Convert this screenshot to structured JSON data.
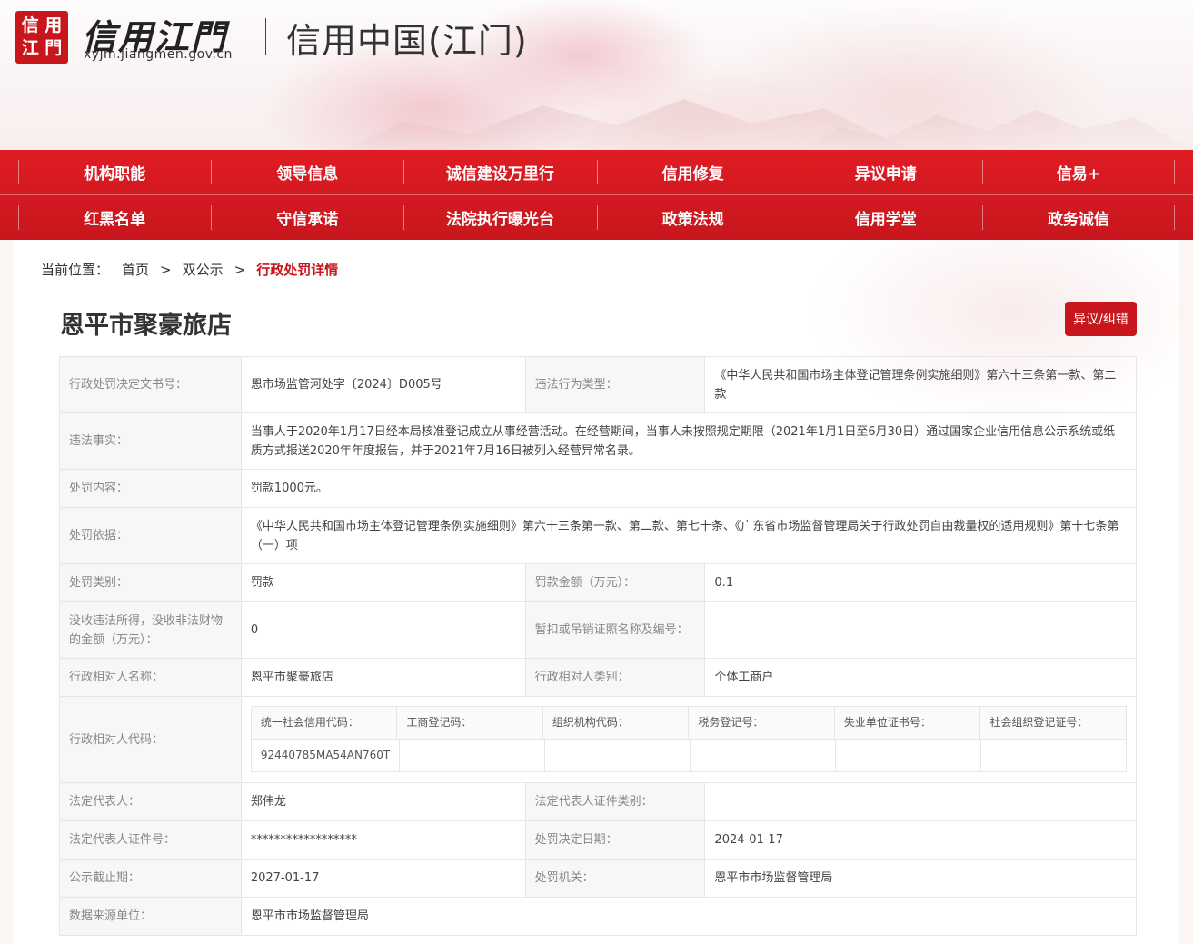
{
  "header": {
    "seal_chars": [
      "信",
      "用",
      "江",
      "門"
    ],
    "brand": "信用江門",
    "url": "xyjm.jiangmen.gov.cn",
    "subtitle": "信用中国(江门)"
  },
  "nav": {
    "row1": [
      "机构职能",
      "领导信息",
      "诚信建设万里行",
      "信用修复",
      "异议申请",
      "信易+"
    ],
    "row2": [
      "红黑名单",
      "守信承诺",
      "法院执行曝光台",
      "政策法规",
      "信用学堂",
      "政务诚信"
    ]
  },
  "breadcrumb": {
    "label": "当前位置：",
    "home": "首页",
    "sep": ">",
    "mid": "双公示",
    "current": "行政处罚详情"
  },
  "page": {
    "title": "恩平市聚豪旅店",
    "objection_button": "异议/纠错"
  },
  "details": {
    "doc_no_label": "行政处罚决定文书号：",
    "doc_no": "恩市场监管河处字〔2024〕D005号",
    "violation_type_label": "违法行为类型：",
    "violation_type": "《中华人民共和国市场主体登记管理条例实施细则》第六十三条第一款、第二款",
    "facts_label": "违法事实：",
    "facts": "当事人于2020年1月17日经本局核准登记成立从事经营活动。在经营期间，当事人未按照规定期限（2021年1月1日至6月30日）通过国家企业信用信息公示系统或纸质方式报送2020年年度报告，并于2021年7月16日被列入经营异常名录。",
    "content_label": "处罚内容：",
    "content": "罚款1000元。",
    "basis_label": "处罚依据：",
    "basis": "《中华人民共和国市场主体登记管理条例实施细则》第六十三条第一款、第二款、第七十条、《广东省市场监督管理局关于行政处罚自由裁量权的适用规则》第十七条第（一）项",
    "category_label": "处罚类别：",
    "category": "罚款",
    "fine_label": "罚款金额（万元）：",
    "fine": "0.1",
    "confiscation_label": "没收违法所得，没收非法财物的金额（万元）：",
    "confiscation": "0",
    "license_label": "暂扣或吊销证照名称及编号：",
    "license": "",
    "party_name_label": "行政相对人名称：",
    "party_name": "恩平市聚豪旅店",
    "party_type_label": "行政相对人类别：",
    "party_type": "个体工商户",
    "party_code_label": "行政相对人代码：",
    "codes": {
      "headers": [
        "统一社会信用代码：",
        "工商登记码：",
        "组织机构代码：",
        "税务登记号：",
        "失业单位证书号：",
        "社会组织登记证号："
      ],
      "values": [
        "92440785MA54AN760T",
        "",
        "",
        "",
        "",
        ""
      ]
    },
    "legal_rep_label": "法定代表人：",
    "legal_rep": "郑伟龙",
    "legal_rep_id_type_label": "法定代表人证件类别：",
    "legal_rep_id_type": "",
    "legal_rep_id_no_label": "法定代表人证件号：",
    "legal_rep_id_no": "******************",
    "decision_date_label": "处罚决定日期：",
    "decision_date": "2024-01-17",
    "publicity_end_label": "公示截止期：",
    "publicity_end": "2027-01-17",
    "authority_label": "处罚机关：",
    "authority": "恩平市市场监督管理局",
    "source_label": "数据来源单位：",
    "source": "恩平市市场监督管理局"
  },
  "colors": {
    "brand_red": "#c8161d",
    "nav_red": "#e01c24"
  }
}
